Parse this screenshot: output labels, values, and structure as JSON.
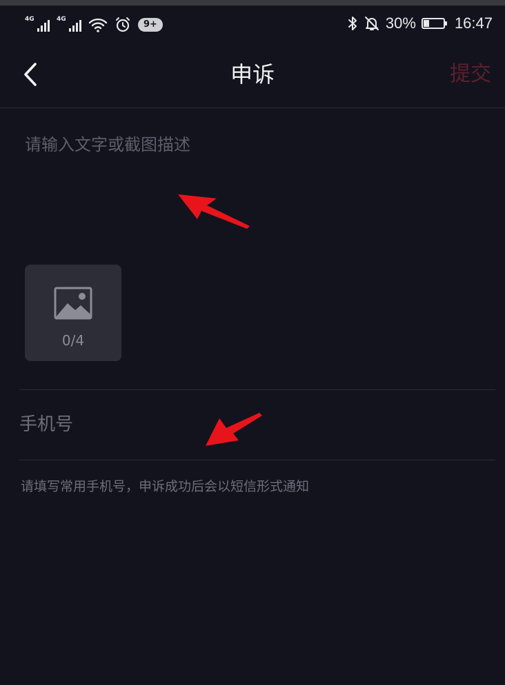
{
  "status_bar": {
    "signal_1_tag": "4G",
    "signal_2_tag": "4G",
    "notification_badge": "9+",
    "battery_percent": "30%",
    "battery_level": 0.3,
    "time": "16:47"
  },
  "nav": {
    "title": "申诉",
    "submit_label": "提交"
  },
  "form": {
    "description_placeholder": "请输入文字或截图描述",
    "upload_count": "0/4",
    "phone_placeholder": "手机号",
    "phone_hint": "请填写常用手机号，申诉成功后会以短信形式通知"
  },
  "colors": {
    "background": "#13131d",
    "submit_disabled": "#5c1f2e",
    "annotation_arrow": "#e8141c"
  },
  "icons": {
    "back": "chevron-left-icon",
    "upload": "image-icon"
  }
}
